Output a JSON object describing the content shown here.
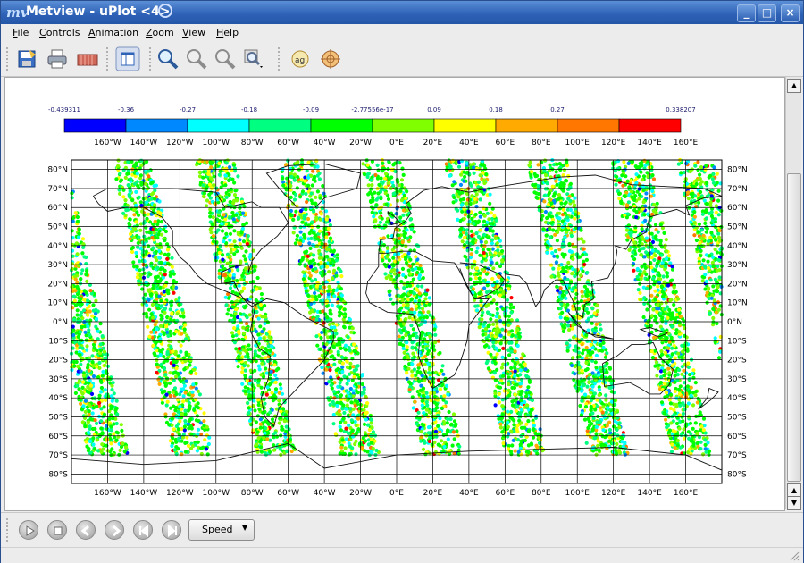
{
  "window": {
    "title": "Metview - uPlot <4>",
    "buttons": [
      "minimize",
      "maximize",
      "close"
    ]
  },
  "menu": [
    "File",
    "Controls",
    "Animation",
    "Zoom",
    "View",
    "Help"
  ],
  "toolbar": [
    "save-icon",
    "print-icon",
    "export-icon",
    "layout-icon",
    "zoom-in-icon",
    "zoom-out-icon",
    "zoom-reset-icon",
    "zoom-stack-icon",
    "magnifier-icon",
    "cursor-data-icon"
  ],
  "playback": {
    "speed_label": "Speed"
  },
  "colors": {
    "title_bar": "#2f63b8",
    "plot_bg": "#ffffff"
  },
  "colorbar": {
    "labels": [
      "-0.439311",
      "-0.36",
      "-0.27",
      "-0.18",
      "-0.09",
      "-2.77556e-17",
      "0.09",
      "0.18",
      "0.27",
      "0.338207"
    ],
    "colors": [
      "#0000ff",
      "#0088ff",
      "#00ffff",
      "#00ff80",
      "#00ff00",
      "#80ff00",
      "#ffff00",
      "#ffaa00",
      "#ff7700",
      "#ff0000"
    ]
  },
  "chart_data": {
    "type": "scatter",
    "projection": "cylindrical",
    "x_ticks": [
      "160°W",
      "140°W",
      "120°W",
      "100°W",
      "80°W",
      "60°W",
      "40°W",
      "20°W",
      "0°E",
      "20°E",
      "40°E",
      "60°E",
      "80°E",
      "100°E",
      "120°E",
      "140°E",
      "160°E"
    ],
    "y_ticks": [
      "80°N",
      "70°N",
      "60°N",
      "50°N",
      "40°N",
      "30°N",
      "20°N",
      "10°N",
      "0°N",
      "10°S",
      "20°S",
      "30°S",
      "40°S",
      "50°S",
      "60°S",
      "70°S",
      "80°S"
    ],
    "xlim": [
      -180,
      180
    ],
    "ylim": [
      -85,
      85
    ],
    "grid": true,
    "swaths": [
      {
        "lon_center": -175,
        "lat_range": [
          -70,
          85
        ]
      },
      {
        "lon_center": -128,
        "lat_range": [
          -70,
          85
        ]
      },
      {
        "lon_center": -82,
        "lat_range": [
          -70,
          85
        ]
      },
      {
        "lon_center": -36,
        "lat_range": [
          -70,
          85
        ]
      },
      {
        "lon_center": 10,
        "lat_range": [
          -70,
          85
        ]
      },
      {
        "lon_center": 56,
        "lat_range": [
          -70,
          85
        ]
      },
      {
        "lon_center": 102,
        "lat_range": [
          -70,
          85
        ]
      },
      {
        "lon_center": 148,
        "lat_range": [
          -70,
          85
        ]
      }
    ]
  }
}
